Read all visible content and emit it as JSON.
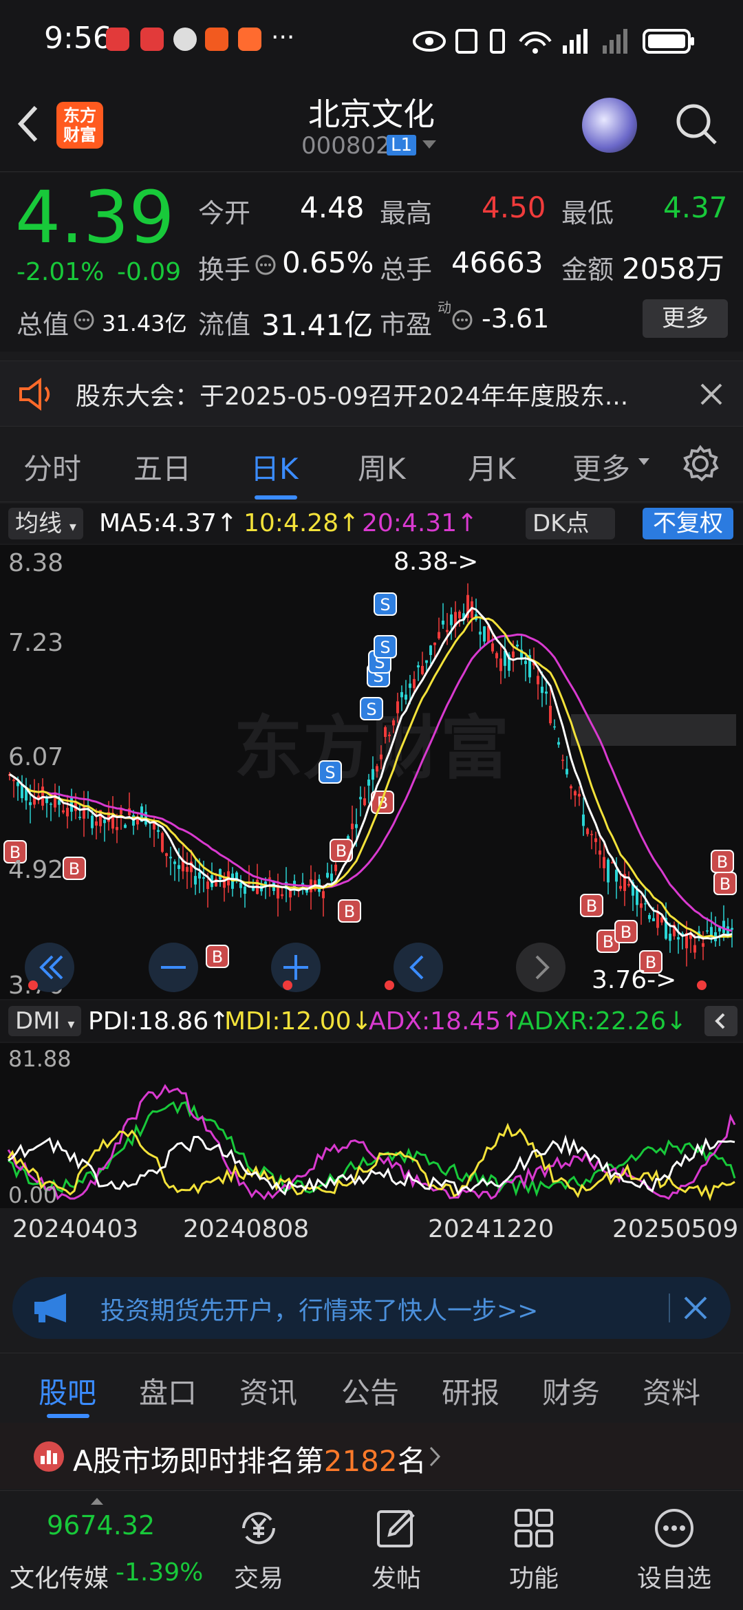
{
  "status": {
    "time": "9:56",
    "more": "···"
  },
  "header": {
    "logo_text": "东方财富",
    "title": "北京文化",
    "code": "000802",
    "level": "L1"
  },
  "quote": {
    "price": "4.39",
    "change_pct": "-2.01%",
    "change": "-0.09",
    "open_label": "今开",
    "open": "4.48",
    "high_label": "最高",
    "high": "4.50",
    "low_label": "最低",
    "low": "4.37",
    "turnover_label": "换手",
    "turnover": "0.65%",
    "volume_label": "总手",
    "volume": "46663",
    "amount_label": "金额",
    "amount": "2058万",
    "mktcap_label": "总值",
    "mktcap": "31.43亿",
    "float_label": "流值",
    "float": "31.41亿",
    "pe_label": "市盈",
    "pe_sup": "动",
    "pe": "-3.61",
    "more_label": "更多"
  },
  "notice": {
    "text": "股东大会：于2025-05-09召开2024年年度股东..."
  },
  "ktabs": [
    "分时",
    "五日",
    "日K",
    "周K",
    "月K",
    "更多"
  ],
  "ma": {
    "selector": "均线",
    "ma5": "MA5:4.37↑",
    "ma10": "10:4.28↑",
    "ma20": "20:4.31↑",
    "dk": "DK点",
    "adjust": "不复权"
  },
  "colors": {
    "up": "#f03b3b",
    "down": "#18c93a",
    "ma10": "#f3e23a",
    "ma20": "#d93ad0",
    "accent": "#3b8cff"
  },
  "kchart": {
    "y_ticks": [
      "8.38",
      "7.23",
      "6.07",
      "4.92",
      "3.76"
    ],
    "max_label": "8.38->",
    "min_label": "3.76->",
    "watermark": "东方财富"
  },
  "dmi": {
    "selector": "DMI",
    "pdi": "PDI:18.86↑",
    "mdi": "MDI:12.00↓",
    "adx": "ADX:18.45↑",
    "adxr": "ADXR:22.26↓",
    "y_top": "81.88",
    "y_bottom": "0.00"
  },
  "dates": [
    "20240403",
    "20240808",
    "20241220",
    "20250509"
  ],
  "ad": {
    "text": "投资期货先开户，行情来了快人一步>>"
  },
  "btabs": [
    "股吧",
    "盘口",
    "资讯",
    "公告",
    "研报",
    "财务",
    "资料"
  ],
  "rank": {
    "prefix": "A股市场即时排名第",
    "num": "2182",
    "suffix": "名"
  },
  "bottom_nav": {
    "index_value": "9674.32",
    "index_name": "文化传媒",
    "index_change": "-1.39%",
    "trade": "交易",
    "post": "发帖",
    "function": "功能",
    "watchlist": "设自选"
  }
}
